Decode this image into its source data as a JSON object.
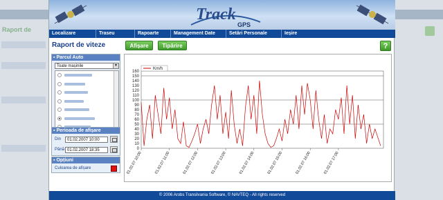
{
  "app": {
    "logo_text": "Track",
    "logo_sub": "GPS"
  },
  "background": {
    "left_title": "Raport de",
    "left_bar": "Localizare"
  },
  "menu": [
    {
      "label": "Localizare"
    },
    {
      "label": "Traseu"
    },
    {
      "label": "Rapoarte"
    },
    {
      "label": "Management Date"
    },
    {
      "label": "Setări Personale"
    },
    {
      "label": "Ieșire"
    }
  ],
  "page": {
    "title": "Raport de viteze",
    "show_button": "Afișare",
    "print_button": "Tipărire",
    "help_button": "?"
  },
  "fleet": {
    "header": "Parcul Auto",
    "select_value": "Toate mașinile",
    "selected_index": 5,
    "vehicle_count": 7
  },
  "period": {
    "header": "Perioada de afișare",
    "from_label": "Din",
    "from_value": "01.02.2007 10:00",
    "to_label": "Până",
    "to_value": "01.02.2007 18:35"
  },
  "options": {
    "header": "Opțiuni",
    "color_label": "Culoarea de afișare",
    "color": "#e01010"
  },
  "footer": {
    "text": "© 2006 Arobs Transilvania Software, © NAVTEQ - All rights reserved"
  },
  "colors": {
    "menu_bg": "#124a9a",
    "accent_green": "#4aa834",
    "series": "#cc0000"
  },
  "chart_data": {
    "type": "line",
    "legend": "Km/h",
    "ylim": [
      0,
      160
    ],
    "yticks": [
      0,
      10,
      20,
      30,
      40,
      50,
      60,
      70,
      80,
      90,
      100,
      110,
      120,
      130,
      140,
      150,
      160
    ],
    "xticks": [
      "01.02.07 10:00",
      "01.02.07 11:00",
      "01.02.07 12:00",
      "01.02.07 13:00",
      "01.02.07 14:00",
      "01.02.07 15:00",
      "01.02.07 16:00",
      "01.02.07 17:00"
    ],
    "series": [
      {
        "name": "Km/h",
        "x_hours": [
          10.0,
          10.1,
          10.2,
          10.3,
          10.4,
          10.5,
          10.6,
          10.7,
          10.8,
          10.9,
          11.0,
          11.1,
          11.2,
          11.3,
          11.4,
          11.5,
          11.6,
          11.7,
          11.8,
          11.9,
          12.0,
          12.1,
          12.2,
          12.3,
          12.4,
          12.5,
          12.6,
          12.7,
          12.8,
          12.9,
          13.0,
          13.1,
          13.2,
          13.3,
          13.4,
          13.5,
          13.6,
          13.7,
          13.8,
          13.9,
          14.0,
          14.1,
          14.2,
          14.3,
          14.4,
          14.5,
          14.6,
          14.7,
          14.8,
          14.9,
          15.0,
          15.1,
          15.2,
          15.3,
          15.4,
          15.5,
          15.6,
          15.7,
          15.8,
          15.9,
          16.0,
          16.1,
          16.2,
          16.3,
          16.4,
          16.5,
          16.6,
          16.7,
          16.8,
          16.9,
          17.0,
          17.1,
          17.2,
          17.3,
          17.4,
          17.5,
          17.6,
          17.7,
          17.8,
          17.9,
          18.0,
          18.1,
          18.2,
          18.3,
          18.5
        ],
        "values": [
          95,
          5,
          60,
          90,
          20,
          110,
          70,
          30,
          125,
          60,
          105,
          40,
          80,
          20,
          10,
          55,
          5,
          2,
          15,
          30,
          50,
          10,
          40,
          60,
          30,
          90,
          130,
          60,
          110,
          30,
          75,
          20,
          120,
          50,
          10,
          40,
          5,
          85,
          130,
          60,
          110,
          30,
          140,
          70,
          30,
          10,
          2,
          5,
          20,
          40,
          15,
          60,
          30,
          80,
          50,
          110,
          40,
          130,
          70,
          135,
          100,
          40,
          120,
          60,
          20,
          70,
          10,
          40,
          30,
          80,
          60,
          105,
          30,
          130,
          50,
          110,
          20,
          90,
          40,
          70,
          10,
          50,
          20,
          40,
          5
        ]
      }
    ]
  }
}
